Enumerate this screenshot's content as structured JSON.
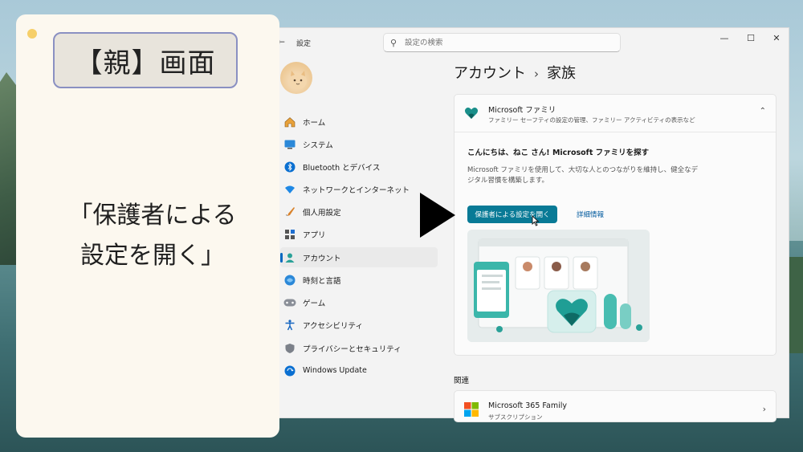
{
  "left_card": {
    "title": "【親】画面",
    "instruction_line1": "「保護者による",
    "instruction_line2": "設定を開く」"
  },
  "window": {
    "app_title": "設定",
    "search_placeholder": "設定の検索",
    "controls": {
      "minimize": "—",
      "maximize": "☐",
      "close": "✕"
    }
  },
  "sidebar": {
    "items": [
      {
        "label": "ホーム",
        "icon": "home-icon"
      },
      {
        "label": "システム",
        "icon": "system-icon"
      },
      {
        "label": "Bluetooth とデバイス",
        "icon": "bluetooth-icon"
      },
      {
        "label": "ネットワークとインターネット",
        "icon": "network-icon"
      },
      {
        "label": "個人用設定",
        "icon": "personalization-icon"
      },
      {
        "label": "アプリ",
        "icon": "apps-icon"
      },
      {
        "label": "アカウント",
        "icon": "account-icon",
        "active": true
      },
      {
        "label": "時刻と言語",
        "icon": "time-language-icon"
      },
      {
        "label": "ゲーム",
        "icon": "gaming-icon"
      },
      {
        "label": "アクセシビリティ",
        "icon": "accessibility-icon"
      },
      {
        "label": "プライバシーとセキュリティ",
        "icon": "privacy-icon"
      },
      {
        "label": "Windows Update",
        "icon": "update-icon"
      }
    ]
  },
  "breadcrumb": {
    "parent": "アカウント",
    "separator": "›",
    "current": "家族"
  },
  "family_card": {
    "name": "Microsoft ファミリ",
    "description": "ファミリー セーフティの設定の管理、ファミリー アクティビティの表示など",
    "greeting": "こんにちは、ねこ さん! Microsoft ファミリを探す",
    "body": "Microsoft ファミリを使用して、大切な人とのつながりを維持し、健全なデジタル習慣を構築します。",
    "primary_button": "保護者による設定を開く",
    "link": "詳細情報"
  },
  "related": {
    "label": "関連",
    "item_name": "Microsoft 365 Family",
    "item_sub": "サブスクリプション"
  },
  "colors": {
    "accent": "#087a96",
    "card_bg": "#fcf8ef",
    "title_border": "#8a90c2",
    "dot": "#f6cf69"
  }
}
